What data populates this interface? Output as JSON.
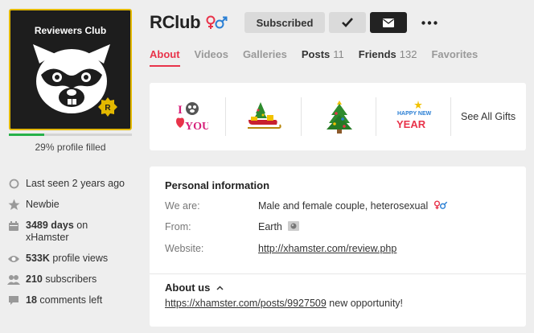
{
  "profile": {
    "avatar_title": "Reviewers Club",
    "avatar_badge_letter": "R",
    "progress_percent": 29,
    "progress_text": "29% profile filled",
    "name": "RClub"
  },
  "stats": {
    "last_seen": "Last seen 2 years ago",
    "rank": "Newbie",
    "days_value": "3489 days",
    "days_suffix": " on",
    "days_line2": "xHamster",
    "views_value": "533K",
    "views_suffix": " profile views",
    "subscribers_value": "210",
    "subscribers_suffix": " subscribers",
    "comments_value": "18",
    "comments_suffix": " comments left"
  },
  "header": {
    "subscribed_label": "Subscribed"
  },
  "tabs": [
    {
      "label": "About",
      "count": ""
    },
    {
      "label": "Videos",
      "count": ""
    },
    {
      "label": "Galleries",
      "count": ""
    },
    {
      "label": "Posts",
      "count": "11"
    },
    {
      "label": "Friends",
      "count": "132"
    },
    {
      "label": "Favorites",
      "count": ""
    }
  ],
  "gifts": {
    "see_all": "See All Gifts",
    "gift1_text_top": "I",
    "gift1_text_bottom": "YOU",
    "gift4_text_top": "HAPPY NEW",
    "gift4_text_bottom": "YEAR"
  },
  "info": {
    "heading": "Personal information",
    "we_are_label": "We are:",
    "we_are_value": "Male and female couple, heterosexual",
    "from_label": "From:",
    "from_value": "Earth",
    "website_label": "Website:",
    "website_value": "http://xhamster.com/review.php",
    "about_heading": "About us",
    "about_link": "https://xhamster.com/posts/9927509",
    "about_suffix": " new opportunity!"
  },
  "colors": {
    "accent": "#e8334a",
    "progress": "#27b14a",
    "avatar_border": "#e3b800",
    "female_symbol": "#e8334a",
    "male_symbol": "#2a7fd4"
  }
}
